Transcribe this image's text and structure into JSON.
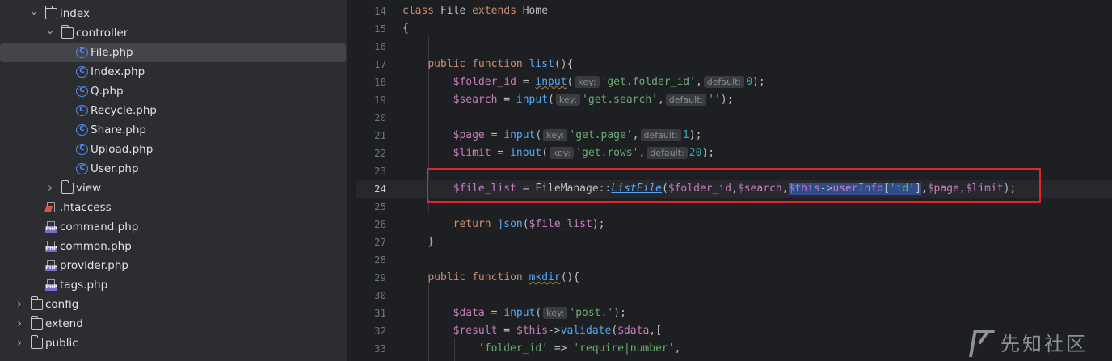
{
  "tree": {
    "items": [
      {
        "label": "index",
        "kind": "folder",
        "expanded": true,
        "depth": 2
      },
      {
        "label": "controller",
        "kind": "folder",
        "expanded": true,
        "depth": 3
      },
      {
        "label": "File.php",
        "kind": "class",
        "depth": 4,
        "selected": true
      },
      {
        "label": "Index.php",
        "kind": "class",
        "depth": 4
      },
      {
        "label": "Q.php",
        "kind": "class",
        "depth": 4
      },
      {
        "label": "Recycle.php",
        "kind": "class",
        "depth": 4
      },
      {
        "label": "Share.php",
        "kind": "class",
        "depth": 4
      },
      {
        "label": "Upload.php",
        "kind": "class",
        "depth": 4
      },
      {
        "label": "User.php",
        "kind": "class",
        "depth": 4
      },
      {
        "label": "view",
        "kind": "folder",
        "expanded": false,
        "depth": 3
      },
      {
        "label": ".htaccess",
        "kind": "htaccess",
        "depth": 3
      },
      {
        "label": "command.php",
        "kind": "php",
        "depth": 3
      },
      {
        "label": "common.php",
        "kind": "php",
        "depth": 3
      },
      {
        "label": "provider.php",
        "kind": "php",
        "depth": 3
      },
      {
        "label": "tags.php",
        "kind": "php",
        "depth": 3
      },
      {
        "label": "config",
        "kind": "folder",
        "expanded": false,
        "depth": 1
      },
      {
        "label": "extend",
        "kind": "folder",
        "expanded": false,
        "depth": 1
      },
      {
        "label": "public",
        "kind": "folder",
        "expanded": false,
        "depth": 1
      }
    ]
  },
  "editor": {
    "current_line": 24,
    "line_numbers": [
      "14",
      "15",
      "16",
      "17",
      "18",
      "19",
      "20",
      "21",
      "22",
      "23",
      "24",
      "25",
      "26",
      "27",
      "28",
      "29",
      "30",
      "31",
      "32",
      "33"
    ],
    "lines": {
      "l14": {
        "kw1": "class",
        "name": "File",
        "kw2": "extends",
        "parent": "Home"
      },
      "l15": {
        "text": "{"
      },
      "l17": {
        "kw1": "public",
        "kw2": "function",
        "fn": "list",
        "rest": "(){"
      },
      "l18": {
        "var": "$folder_id",
        "eq": " = ",
        "fn": "input",
        "open": "(",
        "hint1": "key:",
        "str": "'get.folder_id'",
        "comma": ",",
        "hint2": "default:",
        "num": "0",
        "close": ");"
      },
      "l19": {
        "var": "$search",
        "eq": " = ",
        "fn": "input",
        "open": "(",
        "hint1": "key:",
        "str": "'get.search'",
        "comma": ",",
        "hint2": "default:",
        "str2": "''",
        "close": ");"
      },
      "l21": {
        "var": "$page",
        "eq": " = ",
        "fn": "input",
        "open": "(",
        "hint1": "key:",
        "str": "'get.page'",
        "comma": ",",
        "hint2": "default:",
        "num": "1",
        "close": ");"
      },
      "l22": {
        "var": "$limit",
        "eq": " = ",
        "fn": "input",
        "open": "(",
        "hint1": "key:",
        "str": "'get.rows'",
        "comma": ",",
        "hint2": "default:",
        "num": "20",
        "close": ");"
      },
      "l24": {
        "var": "$file_list",
        "eq": " = ",
        "cls": "FileManage",
        "sep": "::",
        "sfn": "ListFile",
        "open": "(",
        "a1": "$folder_id",
        "c1": ",",
        "a2": "$search",
        "c2": ",",
        "a3": "$this",
        "arrow": "->",
        "prop": "userInfo",
        "br1": "[",
        "key": "'id'",
        "br2": "]",
        "c3": ",",
        "a4": "$page",
        "c4": ",",
        "a5": "$limit",
        "close": ");"
      },
      "l26": {
        "kw": "return",
        "fn": "json",
        "open": "(",
        "var": "$file_list",
        "close": ");"
      },
      "l27": {
        "text": "}"
      },
      "l29": {
        "kw1": "public",
        "kw2": "function",
        "fn": "mkdir",
        "rest": "(){"
      },
      "l31": {
        "var": "$data",
        "eq": " = ",
        "fn": "input",
        "open": "(",
        "hint1": "key:",
        "str": "'post.'",
        "close": ");"
      },
      "l32": {
        "var": "$result",
        "eq": " = ",
        "var2": "$this",
        "arrow": "->",
        "fn": "validate",
        "open": "(",
        "var3": "$data",
        "rest": ",["
      },
      "l33": {
        "str1": "'folder_id'",
        "arrow": " => ",
        "str2": "'require|number'",
        "rest": ","
      }
    }
  },
  "watermark": {
    "text": "先知社区"
  }
}
